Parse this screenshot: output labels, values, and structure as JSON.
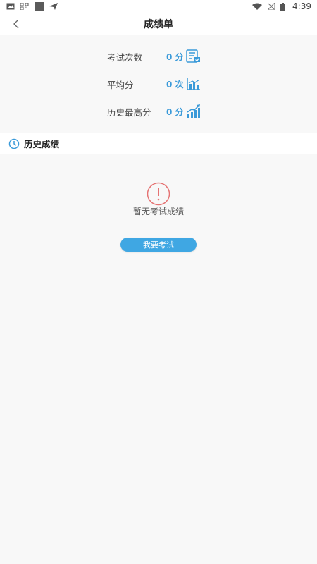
{
  "status_bar": {
    "time": "4:39"
  },
  "header": {
    "title": "成绩单"
  },
  "stats": [
    {
      "label": "考试次数",
      "value": "0 分",
      "icon": "exam-list-icon"
    },
    {
      "label": "平均分",
      "value": "0 次",
      "icon": "bar-chart-icon"
    },
    {
      "label": "历史最高分",
      "value": "0 分",
      "icon": "trend-up-icon"
    }
  ],
  "history": {
    "title": "历史成绩",
    "empty_text": "暂无考试成绩",
    "button_label": "我要考试"
  },
  "colors": {
    "accent": "#3a9ad9",
    "button": "#3fa7e3",
    "warning": "#e57373"
  }
}
